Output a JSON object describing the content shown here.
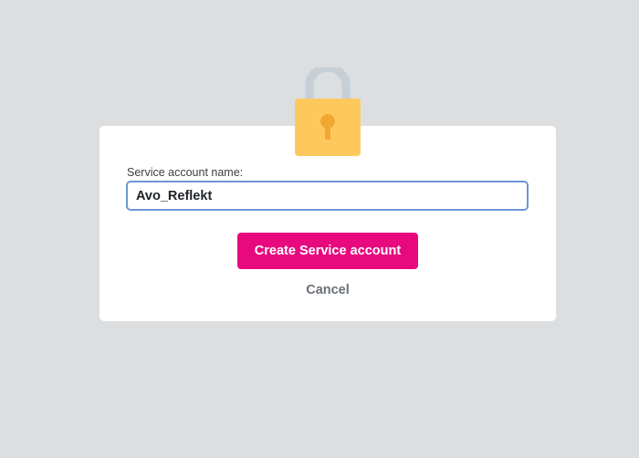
{
  "dialog": {
    "icon": "padlock-icon",
    "field_label": "Service account name:",
    "field_value": "Avo_Reflekt",
    "create_label": "Create Service account",
    "cancel_label": "Cancel"
  },
  "colors": {
    "background": "#dcdee0",
    "card": "#ffffff",
    "primary_button": "#e8097f",
    "input_focus_border": "#6c96d6",
    "lock_body": "#fec95c",
    "lock_shackle": "#c6ced6",
    "lock_keyhole": "#f0a832"
  }
}
